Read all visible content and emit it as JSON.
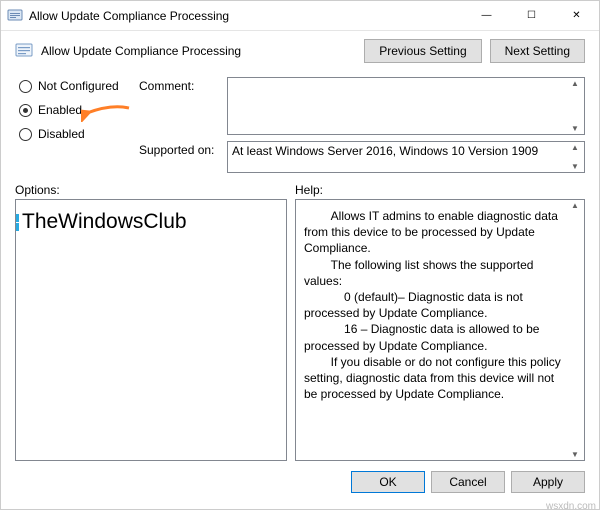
{
  "window": {
    "title": "Allow Update Compliance Processing",
    "minimize": "—",
    "maximize": "☐",
    "close": "✕"
  },
  "header": {
    "title": "Allow Update Compliance Processing",
    "prev": "Previous Setting",
    "next": "Next Setting"
  },
  "radios": {
    "not_configured": "Not Configured",
    "enabled": "Enabled",
    "disabled": "Disabled",
    "selected": "enabled"
  },
  "fields": {
    "comment_label": "Comment:",
    "comment_value": "",
    "supported_label": "Supported on:",
    "supported_value": "At least Windows Server 2016, Windows 10 Version 1909"
  },
  "columns": {
    "options": "Options:",
    "help": "Help:"
  },
  "watermark": "TheWindowsClub",
  "help_text": "        Allows IT admins to enable diagnostic data from this device to be processed by Update Compliance.\n        The following list shows the supported values:\n            0 (default)– Diagnostic data is not processed by Update Compliance.\n            16 – Diagnostic data is allowed to be processed by Update Compliance.\n        If you disable or do not configure this policy setting, diagnostic data from this device will not be processed by Update Compliance.",
  "buttons": {
    "ok": "OK",
    "cancel": "Cancel",
    "apply": "Apply"
  },
  "credit": "wsxdn.com"
}
